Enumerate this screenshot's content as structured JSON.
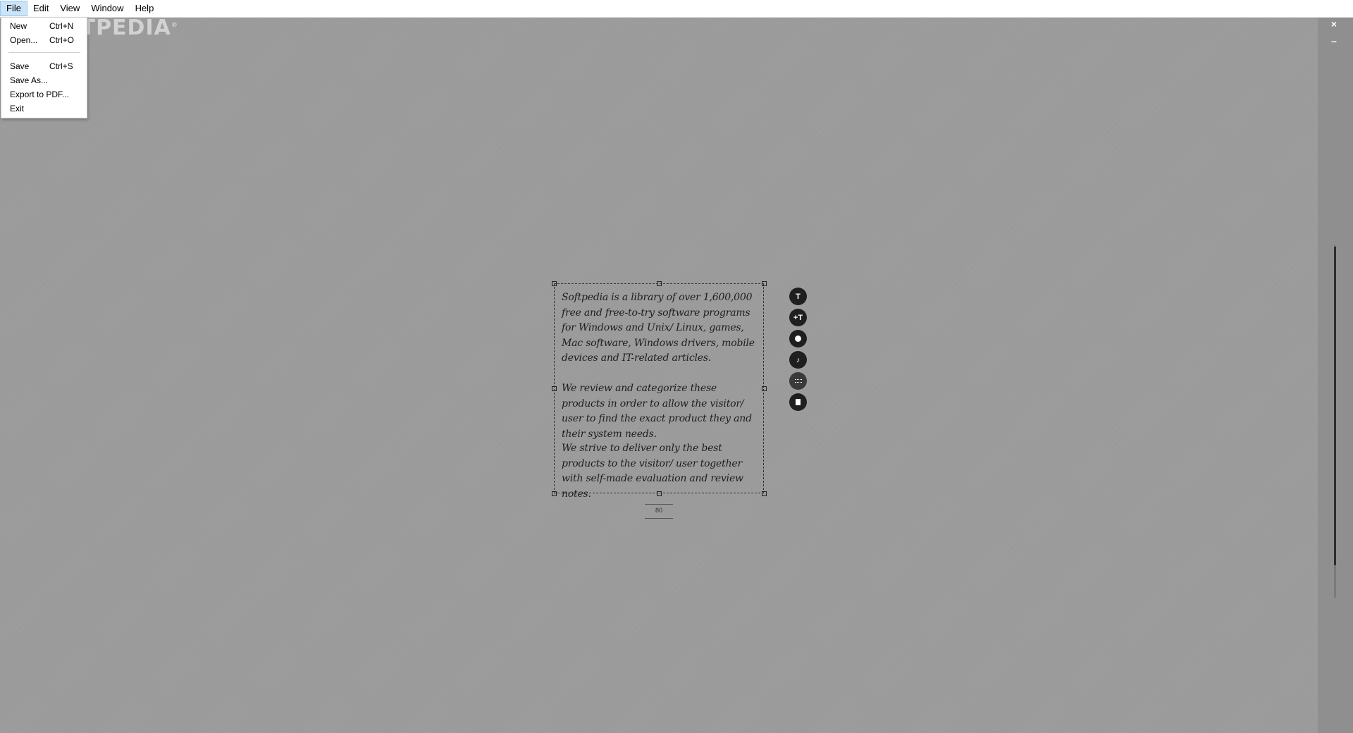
{
  "menubar": {
    "items": [
      {
        "label": "File"
      },
      {
        "label": "Edit"
      },
      {
        "label": "View"
      },
      {
        "label": "Window"
      },
      {
        "label": "Help"
      }
    ]
  },
  "watermark": {
    "text": "SOFTPEDIA",
    "mark": "®"
  },
  "file_menu": {
    "items": [
      {
        "label": "New",
        "shortcut": "Ctrl+N"
      },
      {
        "label": "Open...",
        "shortcut": "Ctrl+O"
      },
      {
        "label": "Save",
        "shortcut": "Ctrl+S"
      },
      {
        "label": "Save As...",
        "shortcut": ""
      },
      {
        "label": "Export to PDF...",
        "shortcut": ""
      },
      {
        "label": "Exit",
        "shortcut": ""
      }
    ]
  },
  "window_controls": {
    "close": "×",
    "minimize": "–"
  },
  "document": {
    "paragraphs": [
      "Softpedia is a library of over 1,600,000 free and free-to-try software programs for Windows and Unix/ Linux, games, Mac software, Windows drivers, mobile devices and IT-related articles.",
      "We review and categorize these products in order to allow the visitor/ user to find the exact product they and their system needs.",
      "We strive to deliver only the best products to the visitor/ user together with self-made evaluation and review notes."
    ],
    "size_value": "80"
  },
  "tools": {
    "text_tool": "T",
    "font_size_tool": "+T",
    "color_tool_icon": "circle-fill-icon",
    "audio_tool_icon": "music-note-icon",
    "spacing_tool_icon": "dotted-lines-icon",
    "page_tool_icon": "page-icon"
  },
  "colors": {
    "canvas": "#9c9c9c",
    "menubar": "#ffffff",
    "tool_button": "#1f1f1f",
    "menu_highlight": "#cce4f7"
  }
}
